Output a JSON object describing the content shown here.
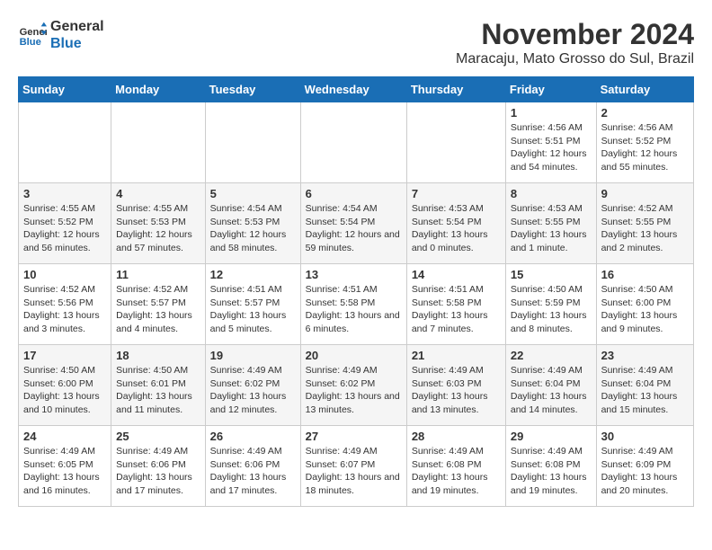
{
  "header": {
    "logo_line1": "General",
    "logo_line2": "Blue",
    "month_title": "November 2024",
    "location": "Maracaju, Mato Grosso do Sul, Brazil"
  },
  "days_of_week": [
    "Sunday",
    "Monday",
    "Tuesday",
    "Wednesday",
    "Thursday",
    "Friday",
    "Saturday"
  ],
  "weeks": [
    [
      {
        "day": "",
        "info": ""
      },
      {
        "day": "",
        "info": ""
      },
      {
        "day": "",
        "info": ""
      },
      {
        "day": "",
        "info": ""
      },
      {
        "day": "",
        "info": ""
      },
      {
        "day": "1",
        "info": "Sunrise: 4:56 AM\nSunset: 5:51 PM\nDaylight: 12 hours and 54 minutes."
      },
      {
        "day": "2",
        "info": "Sunrise: 4:56 AM\nSunset: 5:52 PM\nDaylight: 12 hours and 55 minutes."
      }
    ],
    [
      {
        "day": "3",
        "info": "Sunrise: 4:55 AM\nSunset: 5:52 PM\nDaylight: 12 hours and 56 minutes."
      },
      {
        "day": "4",
        "info": "Sunrise: 4:55 AM\nSunset: 5:53 PM\nDaylight: 12 hours and 57 minutes."
      },
      {
        "day": "5",
        "info": "Sunrise: 4:54 AM\nSunset: 5:53 PM\nDaylight: 12 hours and 58 minutes."
      },
      {
        "day": "6",
        "info": "Sunrise: 4:54 AM\nSunset: 5:54 PM\nDaylight: 12 hours and 59 minutes."
      },
      {
        "day": "7",
        "info": "Sunrise: 4:53 AM\nSunset: 5:54 PM\nDaylight: 13 hours and 0 minutes."
      },
      {
        "day": "8",
        "info": "Sunrise: 4:53 AM\nSunset: 5:55 PM\nDaylight: 13 hours and 1 minute."
      },
      {
        "day": "9",
        "info": "Sunrise: 4:52 AM\nSunset: 5:55 PM\nDaylight: 13 hours and 2 minutes."
      }
    ],
    [
      {
        "day": "10",
        "info": "Sunrise: 4:52 AM\nSunset: 5:56 PM\nDaylight: 13 hours and 3 minutes."
      },
      {
        "day": "11",
        "info": "Sunrise: 4:52 AM\nSunset: 5:57 PM\nDaylight: 13 hours and 4 minutes."
      },
      {
        "day": "12",
        "info": "Sunrise: 4:51 AM\nSunset: 5:57 PM\nDaylight: 13 hours and 5 minutes."
      },
      {
        "day": "13",
        "info": "Sunrise: 4:51 AM\nSunset: 5:58 PM\nDaylight: 13 hours and 6 minutes."
      },
      {
        "day": "14",
        "info": "Sunrise: 4:51 AM\nSunset: 5:58 PM\nDaylight: 13 hours and 7 minutes."
      },
      {
        "day": "15",
        "info": "Sunrise: 4:50 AM\nSunset: 5:59 PM\nDaylight: 13 hours and 8 minutes."
      },
      {
        "day": "16",
        "info": "Sunrise: 4:50 AM\nSunset: 6:00 PM\nDaylight: 13 hours and 9 minutes."
      }
    ],
    [
      {
        "day": "17",
        "info": "Sunrise: 4:50 AM\nSunset: 6:00 PM\nDaylight: 13 hours and 10 minutes."
      },
      {
        "day": "18",
        "info": "Sunrise: 4:50 AM\nSunset: 6:01 PM\nDaylight: 13 hours and 11 minutes."
      },
      {
        "day": "19",
        "info": "Sunrise: 4:49 AM\nSunset: 6:02 PM\nDaylight: 13 hours and 12 minutes."
      },
      {
        "day": "20",
        "info": "Sunrise: 4:49 AM\nSunset: 6:02 PM\nDaylight: 13 hours and 13 minutes."
      },
      {
        "day": "21",
        "info": "Sunrise: 4:49 AM\nSunset: 6:03 PM\nDaylight: 13 hours and 13 minutes."
      },
      {
        "day": "22",
        "info": "Sunrise: 4:49 AM\nSunset: 6:04 PM\nDaylight: 13 hours and 14 minutes."
      },
      {
        "day": "23",
        "info": "Sunrise: 4:49 AM\nSunset: 6:04 PM\nDaylight: 13 hours and 15 minutes."
      }
    ],
    [
      {
        "day": "24",
        "info": "Sunrise: 4:49 AM\nSunset: 6:05 PM\nDaylight: 13 hours and 16 minutes."
      },
      {
        "day": "25",
        "info": "Sunrise: 4:49 AM\nSunset: 6:06 PM\nDaylight: 13 hours and 17 minutes."
      },
      {
        "day": "26",
        "info": "Sunrise: 4:49 AM\nSunset: 6:06 PM\nDaylight: 13 hours and 17 minutes."
      },
      {
        "day": "27",
        "info": "Sunrise: 4:49 AM\nSunset: 6:07 PM\nDaylight: 13 hours and 18 minutes."
      },
      {
        "day": "28",
        "info": "Sunrise: 4:49 AM\nSunset: 6:08 PM\nDaylight: 13 hours and 19 minutes."
      },
      {
        "day": "29",
        "info": "Sunrise: 4:49 AM\nSunset: 6:08 PM\nDaylight: 13 hours and 19 minutes."
      },
      {
        "day": "30",
        "info": "Sunrise: 4:49 AM\nSunset: 6:09 PM\nDaylight: 13 hours and 20 minutes."
      }
    ]
  ]
}
